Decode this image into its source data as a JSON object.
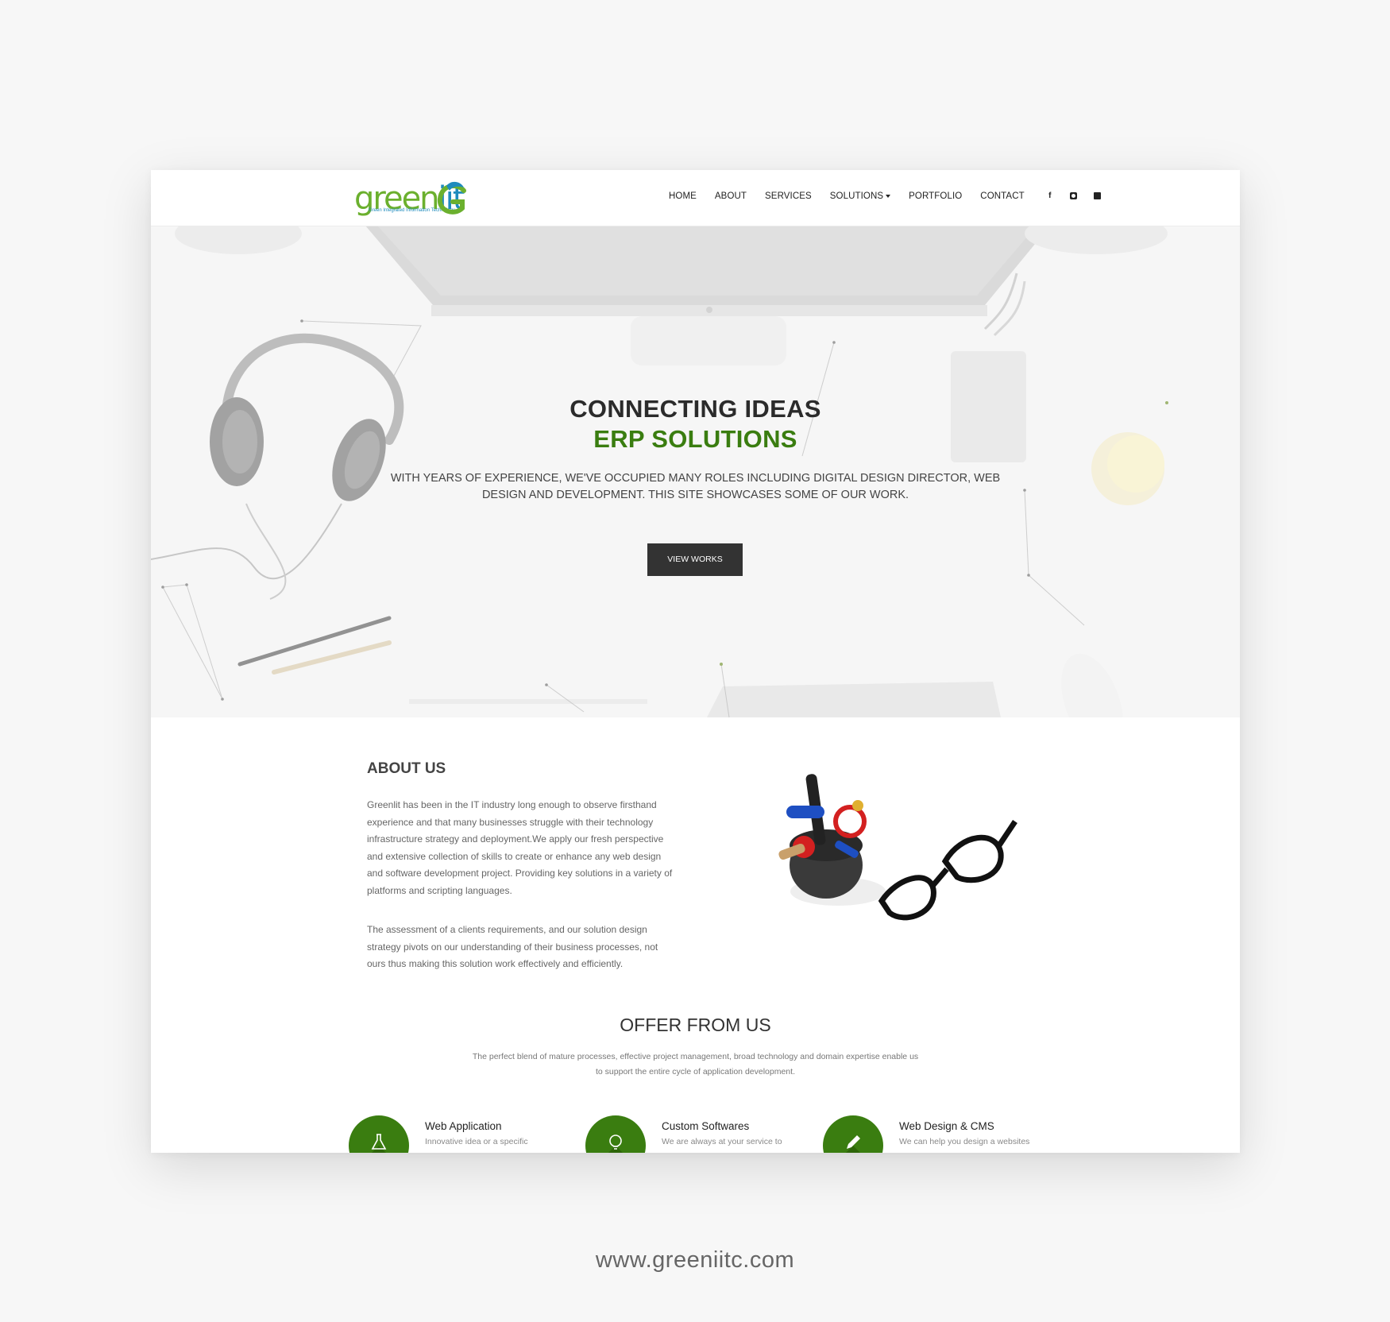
{
  "nav": {
    "logo": {
      "word_a": "green",
      "word_b": "iit",
      "tagline": "Green Integrated Information Technology"
    },
    "menu": [
      {
        "label": "HOME"
      },
      {
        "label": "ABOUT"
      },
      {
        "label": "SERVICES"
      },
      {
        "label": "SOLUTIONS",
        "has_dropdown": true
      },
      {
        "label": "PORTFOLIO"
      },
      {
        "label": "CONTACT"
      }
    ],
    "social": {
      "facebook": "f",
      "instagram": "instagram-icon",
      "linkedin": "linkedin-icon"
    }
  },
  "hero": {
    "title_line1": "CONNECTING IDEAS",
    "title_line2": "ERP SOLUTIONS",
    "subtitle": "WITH YEARS OF EXPERIENCE, WE'VE OCCUPIED MANY ROLES INCLUDING DIGITAL DESIGN DIRECTOR, WEB DESIGN AND DEVELOPMENT. THIS SITE SHOWCASES SOME OF OUR WORK.",
    "button": "VIEW WORKS"
  },
  "about": {
    "title": "ABOUT US",
    "paragraph1": "Greenlit has been in the IT industry long enough to observe firsthand experience and that many businesses struggle with their technology infrastructure strategy and deployment.We apply our fresh perspective and extensive collection of skills to create or enhance any web design and software development project. Providing key solutions in a variety of platforms and scripting languages.",
    "paragraph2": "The assessment of a clients requirements, and our solution design strategy pivots on our understanding of their business processes, not ours thus making this solution work effectively and efficiently."
  },
  "offer": {
    "title": "OFFER FROM US",
    "subtitle": "The perfect blend of mature processes, effective project management, broad technology and domain expertise enable us to support the entire cycle of application development.",
    "services": [
      {
        "name": "Web Application",
        "desc": "Innovative idea or a specific",
        "icon": "flask-icon"
      },
      {
        "name": "Custom Softwares",
        "desc": "We are always at your service to",
        "icon": "lightbulb-icon"
      },
      {
        "name": "Web Design & CMS",
        "desc": "We can help you design a websites",
        "icon": "pencil-icon"
      }
    ]
  },
  "colors": {
    "brand_green": "#3a7d10",
    "dark_button": "#333333",
    "logo_blue": "#1f8bbd",
    "logo_green": "#6bb02e"
  },
  "footer": {
    "url": "www.greeniitc.com"
  }
}
